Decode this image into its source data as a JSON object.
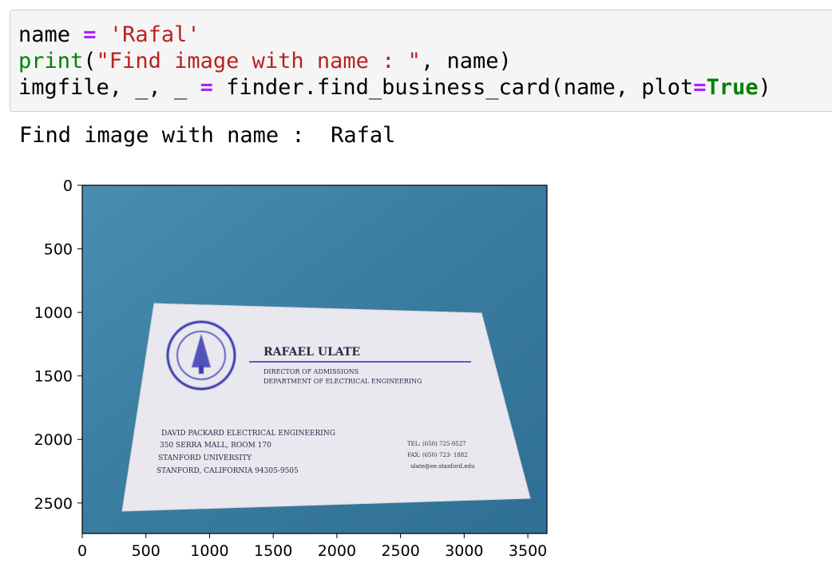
{
  "code_cell": {
    "lines": [
      [
        {
          "text": "name ",
          "cls": ""
        },
        {
          "text": "=",
          "cls": "tok-op"
        },
        {
          "text": " ",
          "cls": ""
        },
        {
          "text": "'Rafal'",
          "cls": "tok-str"
        }
      ],
      [
        {
          "text": "print",
          "cls": "tok-builtin"
        },
        {
          "text": "(",
          "cls": ""
        },
        {
          "text": "\"Find image with name : \"",
          "cls": "tok-str"
        },
        {
          "text": ", name)",
          "cls": ""
        }
      ],
      [
        {
          "text": "imgfile, _, _ ",
          "cls": ""
        },
        {
          "text": "=",
          "cls": "tok-op"
        },
        {
          "text": " finder.find_business_card(name, plot",
          "cls": ""
        },
        {
          "text": "=",
          "cls": "tok-op"
        },
        {
          "text": "True",
          "cls": "tok-kw"
        },
        {
          "text": ")",
          "cls": ""
        }
      ]
    ]
  },
  "output": {
    "text": "Find image with name :  Rafal"
  },
  "plot": {
    "x_ticks": [
      "0",
      "500",
      "1000",
      "1500",
      "2000",
      "2500",
      "3000",
      "3500"
    ],
    "y_ticks": [
      "0",
      "500",
      "1000",
      "1500",
      "2000",
      "2500"
    ],
    "x_range": [
      0,
      3650
    ],
    "y_range": [
      0,
      2740
    ],
    "image": {
      "background_color": "#3d7fa3",
      "card_color": "#e9e8ee",
      "ink_color": "#3b3bb0",
      "card": {
        "name": "RAFAEL ULATE",
        "title_line1": "DIRECTOR OF ADMISSIONS",
        "title_line2": "DEPARTMENT OF ELECTRICAL ENGINEERING",
        "address": [
          "DAVID PACKARD ELECTRICAL ENGINEERING",
          "350 SERRA MALL, ROOM 170",
          "STANFORD UNIVERSITY",
          "STANFORD, CALIFORNIA 94305-9505"
        ],
        "contact": [
          "TEL: (650) 725-9527",
          "FAX: (650) 723- 1882",
          "ulate@ee.stanford.edu"
        ]
      }
    }
  }
}
